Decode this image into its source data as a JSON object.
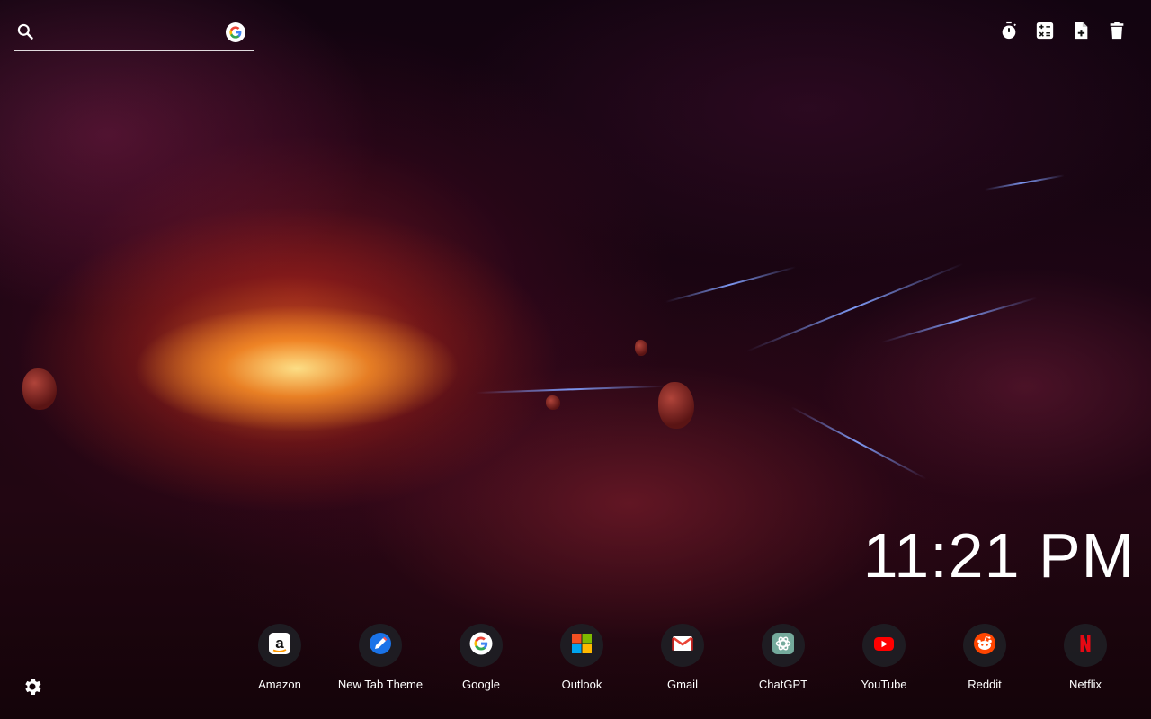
{
  "search": {
    "value": "",
    "placeholder": "",
    "engine_icon": "google-icon"
  },
  "toolbar": [
    {
      "name": "timer-button",
      "icon": "stopwatch-icon"
    },
    {
      "name": "calculator-button",
      "icon": "calculator-icon"
    },
    {
      "name": "add-note-button",
      "icon": "note-add-icon"
    },
    {
      "name": "delete-button",
      "icon": "trash-icon"
    }
  ],
  "clock": {
    "time": "11:21 PM"
  },
  "shortcuts": [
    {
      "label": "Amazon",
      "icon": "amazon-icon"
    },
    {
      "label": "New Tab Theme",
      "icon": "new-tab-theme-icon"
    },
    {
      "label": "Google",
      "icon": "google-icon"
    },
    {
      "label": "Outlook",
      "icon": "microsoft-icon"
    },
    {
      "label": "Gmail",
      "icon": "gmail-icon"
    },
    {
      "label": "ChatGPT",
      "icon": "chatgpt-icon"
    },
    {
      "label": "YouTube",
      "icon": "youtube-icon"
    },
    {
      "label": "Reddit",
      "icon": "reddit-icon"
    },
    {
      "label": "Netflix",
      "icon": "netflix-icon"
    }
  ],
  "settings": {
    "icon": "gear-icon"
  },
  "colors": {
    "text": "#ffffff",
    "tile": "#1e1e24",
    "youtube": "#ff0000",
    "reddit": "#ff4500",
    "netflix": "#e50914"
  }
}
